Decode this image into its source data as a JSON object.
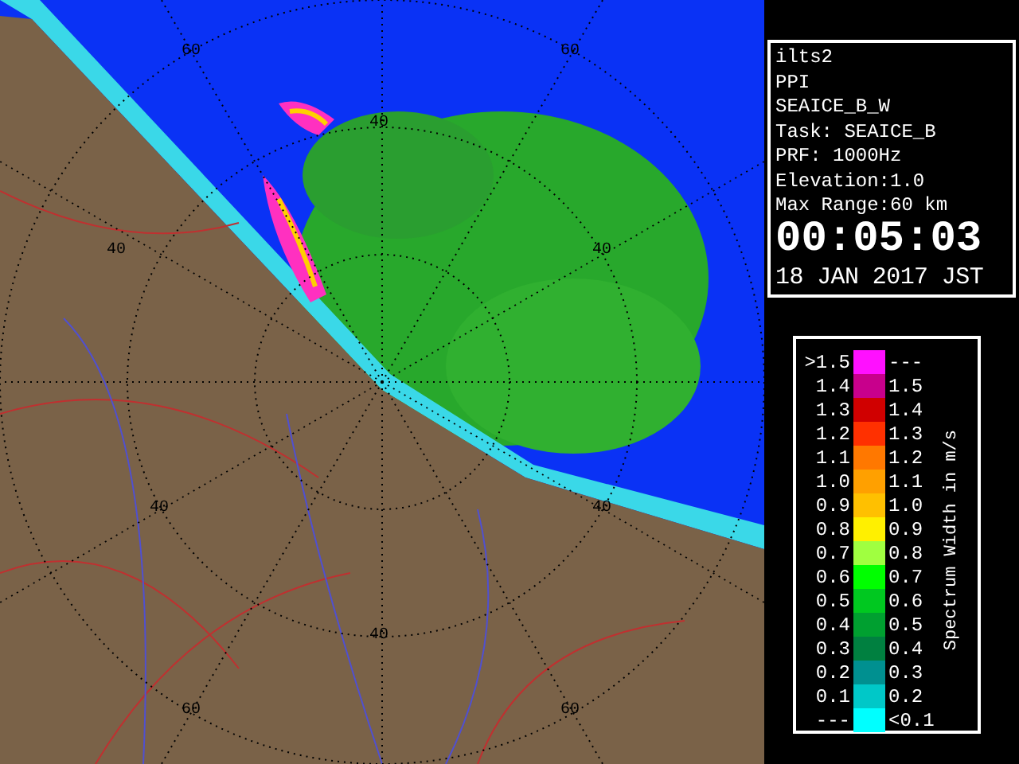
{
  "map": {
    "range_labels": [
      "60",
      "60",
      "40",
      "40",
      "40",
      "40",
      "40",
      "40",
      "60",
      "60"
    ]
  },
  "info": {
    "lines": [
      "ilts2",
      "PPI",
      "SEAICE_B_W",
      "Task: SEAICE_B",
      "PRF: 1000Hz",
      "Elevation:1.0",
      "Max Range:60 km"
    ],
    "time": "00:05:03",
    "date": "18 JAN 2017 JST"
  },
  "legend": {
    "title": "Spectrum Width in m/s",
    "rows": [
      {
        "low": ">1.5",
        "high": "---",
        "color": "#ff10ff"
      },
      {
        "low": "1.4",
        "high": "1.5",
        "color": "#c8008c"
      },
      {
        "low": "1.3",
        "high": "1.4",
        "color": "#d00000"
      },
      {
        "low": "1.2",
        "high": "1.3",
        "color": "#ff3000"
      },
      {
        "low": "1.1",
        "high": "1.2",
        "color": "#ff7800"
      },
      {
        "low": "1.0",
        "high": "1.1",
        "color": "#ffa000"
      },
      {
        "low": "0.9",
        "high": "1.0",
        "color": "#ffc000"
      },
      {
        "low": "0.8",
        "high": "0.9",
        "color": "#fff000"
      },
      {
        "low": "0.7",
        "high": "0.8",
        "color": "#a0ff40"
      },
      {
        "low": "0.6",
        "high": "0.7",
        "color": "#00ff00"
      },
      {
        "low": "0.5",
        "high": "0.6",
        "color": "#00c820"
      },
      {
        "low": "0.4",
        "high": "0.5",
        "color": "#00a030"
      },
      {
        "low": "0.3",
        "high": "0.4",
        "color": "#008040"
      },
      {
        "low": "0.2",
        "high": "0.3",
        "color": "#009090"
      },
      {
        "low": "0.1",
        "high": "0.2",
        "color": "#00c8c8"
      },
      {
        "low": "---",
        "high": "<0.1",
        "color": "#00ffff"
      }
    ]
  }
}
